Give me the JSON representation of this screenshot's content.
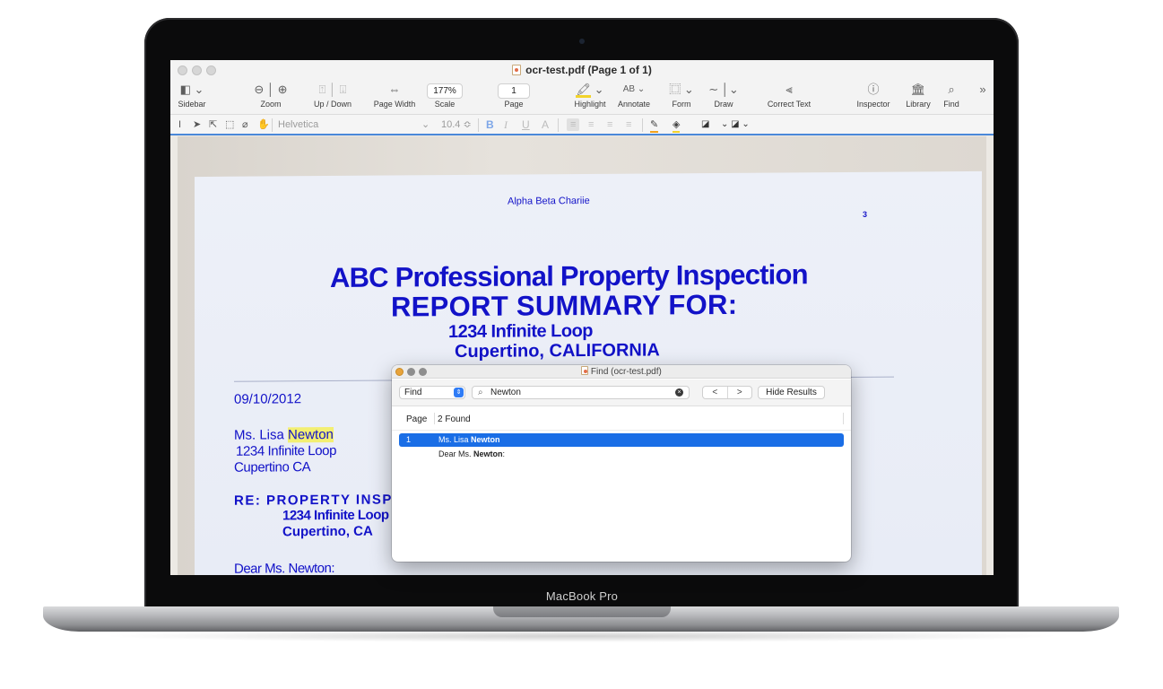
{
  "device": {
    "label": "MacBook Pro"
  },
  "window": {
    "title": "ocr-test.pdf (Page 1 of 1)"
  },
  "toolbar": {
    "sidebar": "Sidebar",
    "zoom": "Zoom",
    "updown": "Up / Down",
    "pagewidth": "Page Width",
    "scale_label": "Scale",
    "scale_value": "177%",
    "page_label": "Page",
    "page_value": "1",
    "highlight": "Highlight",
    "annotate": "Annotate",
    "annotate_icon": "AB",
    "form": "Form",
    "draw": "Draw",
    "correct_text": "Correct Text",
    "inspector": "Inspector",
    "library": "Library",
    "find": "Find"
  },
  "formatbar": {
    "font": "Helvetica",
    "size": "10.4 ≎",
    "bold": "B",
    "italic": "I",
    "underline": "U",
    "strike": "A"
  },
  "document": {
    "header": "Alpha Beta Chariie",
    "page_num": "3",
    "title1": "ABC Professional Property Inspection",
    "title2": "REPORT SUMMARY FOR:",
    "addr1": "1234 Infinite Loop",
    "addr2": "Cupertino, CALIFORNIA",
    "date": "09/10/2012",
    "recipient_name_prefix": "Ms. Lisa ",
    "recipient_name_highlight": "Newton",
    "recipient_street": "1234 Infinite Loop",
    "recipient_city": "Cupertino CA",
    "re_label": "RE: PROPERTY INSP",
    "re_street": "1234 Infinite Loop",
    "re_city": "Cupertino, CA",
    "salutation": "Dear Ms. Newton:"
  },
  "find_panel": {
    "title": "Find (ocr-test.pdf)",
    "mode": "Find",
    "query": "Newton",
    "prev": "<",
    "next": ">",
    "hide_results": "Hide Results",
    "col_page": "Page",
    "col_found": "2 Found",
    "results": [
      {
        "page": "1",
        "prefix": "Ms. Lisa ",
        "match": "Newton",
        "suffix": ""
      },
      {
        "page": "",
        "prefix": "Dear Ms. ",
        "match": "Newton",
        "suffix": ":"
      }
    ]
  },
  "colors": {
    "ocr_text": "#1212c8",
    "selection": "#1a6ee6",
    "highlight": "#f3ef72"
  }
}
